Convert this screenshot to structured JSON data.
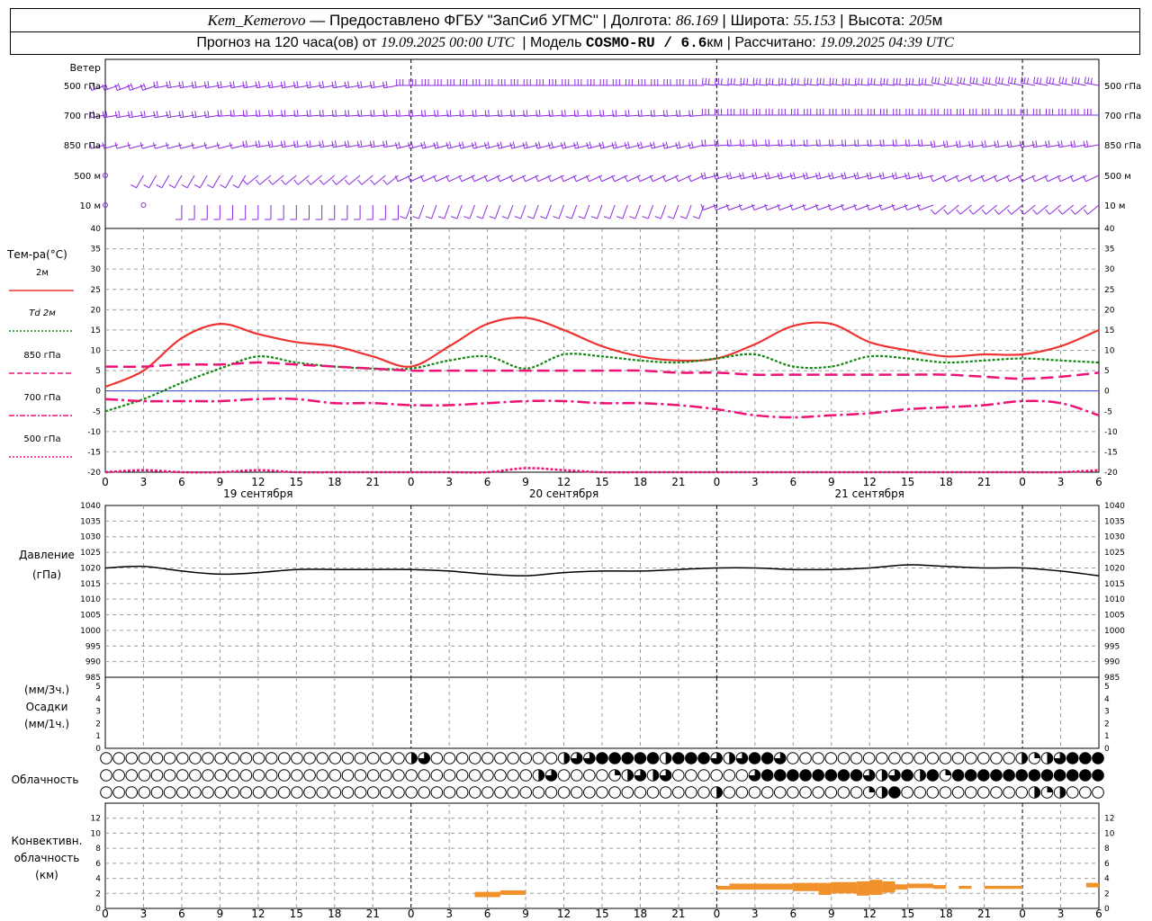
{
  "header": {
    "station": "Kem_Kemerovo",
    "provider_text": "— Предоставлено ФГБУ \"ЗапСиб УГМС\"",
    "lon_label": "Долгота:",
    "lon": "86.169",
    "lat_label": "Широта:",
    "lat": "55.153",
    "alt_label": "Высота:",
    "alt": "205",
    "alt_unit": "м",
    "forecast_text": "Прогноз на 120 часа(ов) от",
    "run_time": "19.09.2025 00:00 UTC",
    "model_label": "Модель",
    "model": "COSMO-RU / 6.6",
    "model_unit": "км",
    "computed_label": "Рассчитано:",
    "computed": "19.09.2025 04:39 UTC"
  },
  "colors": {
    "wind": "#8a2be2",
    "t2m": "#ee3333",
    "td2m": "#118811",
    "t850": "#ee1177",
    "t700": "#ee1177",
    "t500": "#ee1177",
    "pressure": "#000000",
    "convective": "#f0912a",
    "grid": "#9a9a9a"
  },
  "wind_panel": {
    "title": "Ветер",
    "levels": [
      "500 гПа",
      "700 гПа",
      "850 гПа",
      "500 м",
      "10  м"
    ]
  },
  "temp_panel": {
    "title": "Тем-ра(°C)",
    "legend": [
      {
        "label": "2м",
        "key": "t2m"
      },
      {
        "label": "Td 2м",
        "key": "td2m"
      },
      {
        "label": "850 гПа",
        "key": "t850"
      },
      {
        "label": "700 гПа",
        "key": "t700"
      },
      {
        "label": "500 гПа",
        "key": "t500"
      }
    ]
  },
  "pressure_panel": {
    "title": "Давление",
    "unit": "(гПа)"
  },
  "precip_panel": {
    "unit_3h": "(мм/3ч.)",
    "title": "Осадки",
    "unit_1h": "(мм/1ч.)"
  },
  "cloud_panel": {
    "title": "Облачность"
  },
  "conv_panel": {
    "title_1": "Конвективн.",
    "title_2": "облачность",
    "unit": "(км)"
  },
  "hour_labels": [
    "0",
    "3",
    "6",
    "9",
    "12",
    "15",
    "18",
    "21",
    "0",
    "3",
    "6",
    "9",
    "12",
    "15",
    "18",
    "21",
    "0",
    "3",
    "6",
    "9",
    "12",
    "15",
    "18",
    "21",
    "0",
    "3",
    "6"
  ],
  "day_labels": [
    "19 сентября",
    "20 сентября",
    "21 сентября"
  ],
  "chart_data": [
    {
      "type": "line",
      "title": "Тем-ра(°C)",
      "xlabel": "",
      "ylabel": "Тем-ра(°C)",
      "x_unit": "hours since 19.09.2025 00:00 UTC",
      "x": [
        0,
        3,
        6,
        9,
        12,
        15,
        18,
        21,
        24,
        27,
        30,
        33,
        36,
        39,
        42,
        45,
        48,
        51,
        54,
        57,
        60,
        63,
        66,
        69,
        72,
        75,
        78
      ],
      "ylim": [
        -20,
        40
      ],
      "yticks": [
        -20,
        -15,
        -10,
        -5,
        0,
        5,
        10,
        15,
        20,
        25,
        30,
        35,
        40
      ],
      "grid": true,
      "series": [
        {
          "name": "2м",
          "key": "t2m",
          "values": [
            1,
            5,
            13,
            16.5,
            14,
            12,
            11,
            8.5,
            6,
            11,
            16.5,
            18,
            15,
            11,
            8.5,
            7.5,
            8,
            11.5,
            16,
            16.5,
            12,
            10,
            8.5,
            9,
            9,
            11,
            15
          ]
        },
        {
          "name": "Td 2м",
          "key": "td2m",
          "values": [
            -5,
            -2,
            2,
            5.5,
            8.5,
            7,
            6,
            5.5,
            5.5,
            7.5,
            8.5,
            5.5,
            9,
            8.5,
            7.5,
            7,
            8,
            9,
            6,
            6,
            8.5,
            8,
            7,
            7.5,
            8,
            7.5,
            7
          ]
        },
        {
          "name": "850 гПа",
          "key": "t850",
          "values": [
            6,
            6,
            6.5,
            6.5,
            7,
            6.5,
            6,
            5.5,
            5,
            5,
            5,
            5,
            5,
            5,
            5,
            4.5,
            4.5,
            4,
            4,
            4,
            4,
            4,
            4,
            3.5,
            3,
            3.5,
            4.5
          ]
        },
        {
          "name": "700 гПа",
          "key": "t700",
          "values": [
            -2,
            -2.5,
            -2.5,
            -2.5,
            -2,
            -2,
            -3,
            -3,
            -3.5,
            -3.5,
            -3,
            -2.5,
            -2.5,
            -3,
            -3,
            -3.5,
            -4.5,
            -6,
            -6.5,
            -6,
            -5.5,
            -4.5,
            -4,
            -3.5,
            -2.5,
            -3,
            -6
          ]
        },
        {
          "name": "500 гПа",
          "key": "t500",
          "values": [
            -20,
            -19.5,
            -20,
            -20,
            -19.5,
            -20,
            -20,
            -20.5,
            -21,
            -21,
            -20,
            -19,
            -19.5,
            -20,
            -20.5,
            -21,
            -21,
            -21.5,
            -21.5,
            -21.5,
            -21,
            -21,
            -20.5,
            -20.5,
            -20.5,
            -20.5,
            -19.5
          ]
        }
      ]
    },
    {
      "type": "line",
      "title": "Давление",
      "ylabel": "Давление (гПа)",
      "x_unit": "hours since 19.09.2025 00:00 UTC",
      "x": [
        0,
        3,
        6,
        9,
        12,
        15,
        18,
        21,
        24,
        27,
        30,
        33,
        36,
        39,
        42,
        45,
        48,
        51,
        54,
        57,
        60,
        63,
        66,
        69,
        72,
        75,
        78
      ],
      "ylim": [
        985,
        1040
      ],
      "yticks": [
        985,
        990,
        995,
        1000,
        1005,
        1010,
        1015,
        1020,
        1025,
        1030,
        1035,
        1040
      ],
      "grid": true,
      "series": [
        {
          "name": "",
          "key": "pressure",
          "values": [
            1020,
            1020.5,
            1019,
            1018,
            1018.5,
            1019.5,
            1019.5,
            1019.5,
            1019.5,
            1019,
            1018,
            1017.5,
            1018.5,
            1019,
            1019,
            1019.5,
            1020,
            1020,
            1019.5,
            1019.5,
            1020,
            1021,
            1020.5,
            1020,
            1020,
            1019,
            1017.5
          ]
        }
      ]
    },
    {
      "type": "bar",
      "title": "Осадки",
      "ylabel": "(мм/3ч.) / (мм/1ч.)",
      "ylim": [
        0,
        5
      ],
      "yticks": [
        0,
        1,
        2,
        3,
        4,
        5
      ],
      "series": [
        {
          "name": "",
          "values": []
        }
      ]
    },
    {
      "type": "table",
      "title": "Облачность",
      "x_unit": "hours since 19.09.2025 00:00 UTC",
      "step_hours": 1,
      "rows": [
        {
          "fractions": [
            [
              0,
              24,
              0
            ],
            [
              24,
              25,
              0.5
            ],
            [
              25,
              26,
              0.75
            ],
            [
              26,
              36,
              0
            ],
            [
              36,
              37,
              0.5
            ],
            [
              37,
              38,
              0.75
            ],
            [
              38,
              39,
              0.75
            ],
            [
              39,
              44,
              1
            ],
            [
              44,
              45,
              0.5
            ],
            [
              45,
              48,
              1
            ],
            [
              48,
              49,
              0.75
            ],
            [
              49,
              50,
              0.5
            ],
            [
              50,
              51,
              0.75
            ],
            [
              51,
              53,
              1
            ],
            [
              53,
              54,
              0.75
            ],
            [
              54,
              72,
              0
            ],
            [
              72,
              73,
              0.5
            ],
            [
              73,
              74,
              0.25
            ],
            [
              74,
              75,
              0.5
            ],
            [
              75,
              76,
              0.75
            ],
            [
              76,
              78,
              1
            ]
          ]
        },
        {
          "fractions": [
            [
              0,
              34,
              0
            ],
            [
              34,
              35,
              0.5
            ],
            [
              35,
              36,
              0.75
            ],
            [
              36,
              40,
              0
            ],
            [
              40,
              41,
              0.25
            ],
            [
              41,
              42,
              0.5
            ],
            [
              42,
              43,
              0.75
            ],
            [
              43,
              44,
              0.5
            ],
            [
              44,
              45,
              0.75
            ],
            [
              45,
              51,
              0
            ],
            [
              51,
              52,
              0.75
            ],
            [
              52,
              60,
              1
            ],
            [
              60,
              61,
              0.75
            ],
            [
              61,
              62,
              0.5
            ],
            [
              62,
              63,
              0.75
            ],
            [
              63,
              64,
              1
            ],
            [
              64,
              65,
              0.5
            ],
            [
              65,
              66,
              1
            ],
            [
              66,
              67,
              0.25
            ],
            [
              67,
              78,
              1
            ]
          ]
        },
        {
          "fractions": [
            [
              0,
              48,
              0
            ],
            [
              48,
              49,
              0.5
            ],
            [
              49,
              60,
              0
            ],
            [
              60,
              61,
              0.25
            ],
            [
              61,
              62,
              0.5
            ],
            [
              62,
              63,
              1
            ],
            [
              63,
              73,
              0
            ],
            [
              73,
              74,
              0.5
            ],
            [
              74,
              75,
              0.25
            ],
            [
              75,
              76,
              0.5
            ],
            [
              76,
              78,
              0
            ]
          ]
        }
      ]
    },
    {
      "type": "bar",
      "title": "Конвективн. облачность",
      "ylabel": "(км)",
      "x_unit": "hours since 19.09.2025 00:00 UTC",
      "ylim": [
        0,
        14
      ],
      "yticks": [
        0,
        2,
        4,
        6,
        8,
        10,
        12
      ],
      "bars": [
        {
          "x0": 29,
          "x1": 31,
          "bottom": 1.5,
          "top": 2.2
        },
        {
          "x0": 31,
          "x1": 33,
          "bottom": 1.8,
          "top": 2.4
        },
        {
          "x0": 48,
          "x1": 49,
          "bottom": 2.5,
          "top": 3.0
        },
        {
          "x0": 49,
          "x1": 54,
          "bottom": 2.5,
          "top": 3.3
        },
        {
          "x0": 54,
          "x1": 56,
          "bottom": 2.3,
          "top": 3.4
        },
        {
          "x0": 56,
          "x1": 57,
          "bottom": 1.8,
          "top": 3.4
        },
        {
          "x0": 57,
          "x1": 59,
          "bottom": 2.0,
          "top": 3.5
        },
        {
          "x0": 59,
          "x1": 60,
          "bottom": 1.7,
          "top": 3.6
        },
        {
          "x0": 60,
          "x1": 61,
          "bottom": 1.8,
          "top": 3.8
        },
        {
          "x0": 61,
          "x1": 62,
          "bottom": 2.1,
          "top": 3.6
        },
        {
          "x0": 62,
          "x1": 63,
          "bottom": 2.5,
          "top": 3.2
        },
        {
          "x0": 63,
          "x1": 65,
          "bottom": 2.7,
          "top": 3.3
        },
        {
          "x0": 65,
          "x1": 66,
          "bottom": 2.6,
          "top": 3.1
        },
        {
          "x0": 67,
          "x1": 68,
          "bottom": 2.6,
          "top": 3.0
        },
        {
          "x0": 69,
          "x1": 72,
          "bottom": 2.6,
          "top": 3.0
        },
        {
          "x0": 77,
          "x1": 78,
          "bottom": 2.8,
          "top": 3.4
        }
      ]
    }
  ],
  "wind_barbs": {
    "x_step_hours": 1,
    "rows": [
      {
        "level": "500 гПа",
        "segments": [
          [
            0,
            5,
            250,
            15
          ],
          [
            5,
            24,
            260,
            20
          ],
          [
            24,
            48,
            270,
            25
          ],
          [
            48,
            66,
            275,
            30
          ],
          [
            66,
            78,
            280,
            30
          ]
        ]
      },
      {
        "level": "700 гПа",
        "segments": [
          [
            0,
            10,
            260,
            15
          ],
          [
            10,
            24,
            265,
            20
          ],
          [
            24,
            48,
            265,
            20
          ],
          [
            48,
            66,
            270,
            25
          ],
          [
            66,
            78,
            270,
            25
          ]
        ]
      },
      {
        "level": "850 гПа",
        "segments": [
          [
            0,
            12,
            255,
            10
          ],
          [
            12,
            24,
            260,
            15
          ],
          [
            24,
            48,
            255,
            15
          ],
          [
            48,
            66,
            265,
            20
          ],
          [
            66,
            78,
            260,
            15
          ]
        ]
      },
      {
        "level": "500 м",
        "segments": [
          [
            0,
            3,
            0,
            0
          ],
          [
            3,
            12,
            210,
            10
          ],
          [
            12,
            24,
            230,
            10
          ],
          [
            24,
            48,
            245,
            10
          ],
          [
            48,
            66,
            255,
            15
          ],
          [
            66,
            78,
            245,
            10
          ]
        ]
      },
      {
        "level": "10  м",
        "segments": [
          [
            0,
            6,
            0,
            0
          ],
          [
            6,
            24,
            180,
            5
          ],
          [
            24,
            48,
            200,
            5
          ],
          [
            48,
            66,
            250,
            10
          ],
          [
            66,
            78,
            230,
            10
          ]
        ]
      }
    ]
  }
}
